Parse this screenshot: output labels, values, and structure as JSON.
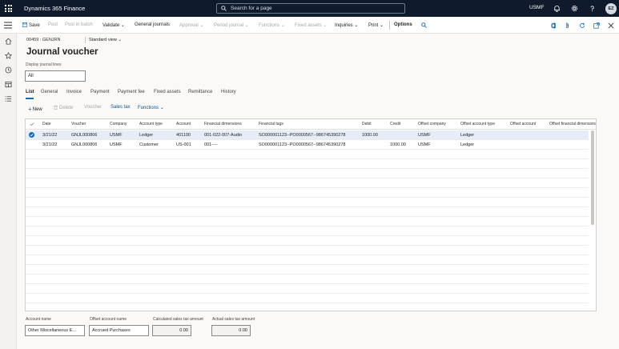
{
  "topbar": {
    "app_title": "Dynamics 365 Finance",
    "search_placeholder": "Search for a page",
    "company": "USMF",
    "user_initials": "EZ"
  },
  "actionbar": {
    "save": "Save",
    "post": "Post",
    "post_in_batch": "Post in batch",
    "validate": "Validate",
    "general_journals": "General journals",
    "approval": "Approval",
    "period_journal": "Period journal",
    "functions": "Functions",
    "fixed_assets": "Fixed assets",
    "inquiries": "Inquiries",
    "print": "Print",
    "options": "Options"
  },
  "breadcrumb": {
    "journal": "00459 : GENJRN",
    "view": "Standard view"
  },
  "page_title": "Journal voucher",
  "display_journal_lines": {
    "label": "Display journal lines",
    "value": "All"
  },
  "tabs": [
    "List",
    "General",
    "Invoice",
    "Payment",
    "Payment fee",
    "Fixed assets",
    "Remittance",
    "History"
  ],
  "grid_actions": {
    "new": "New",
    "delete": "Delete",
    "voucher": "Voucher",
    "sales_tax": "Sales tax",
    "functions": "Functions"
  },
  "grid": {
    "columns": [
      "Date",
      "Voucher",
      "Company",
      "Account type",
      "Account",
      "Financial dimensions",
      "Financial tags",
      "Debit",
      "Credit",
      "Offset company",
      "Offset account type",
      "Offset account",
      "Offset financial dimensions"
    ],
    "rows": [
      {
        "date": "3/21/22",
        "voucher": "GNJL000806",
        "company": "USMF",
        "account_type": "Ledger",
        "account": "401100",
        "financial_dimensions": "001-022-007-Audio",
        "financial_tags": "SO000001123--PO0000567--986745390278",
        "debit": "1000.00",
        "credit": "",
        "offset_company": "USMF",
        "offset_account_type": "Ledger",
        "offset_account": "",
        "offset_financial_dimensions": ""
      },
      {
        "date": "3/21/22",
        "voucher": "GNJL000806",
        "company": "USMF",
        "account_type": "Customer",
        "account": "US-001",
        "financial_dimensions": "001----",
        "financial_tags": "SO000001123--PO0000567--986745390278",
        "debit": "",
        "credit": "1000.00",
        "offset_company": "USMF",
        "offset_account_type": "Ledger",
        "offset_account": "",
        "offset_financial_dimensions": ""
      }
    ]
  },
  "footer": {
    "account_name_label": "Account name",
    "account_name_value": "Other Miscellaneous E...",
    "offset_account_name_label": "Offset account name",
    "offset_account_name_value": "Accrued Purchases",
    "calc_tax_label": "Calculated sales tax amount",
    "calc_tax_value": "0.00",
    "actual_tax_label": "Actual sales tax amount",
    "actual_tax_value": "0.00"
  },
  "colors": {
    "topbar_bg": "#0f1b2d",
    "accent": "#0f6cbd",
    "selected_row": "#e6edf7"
  }
}
